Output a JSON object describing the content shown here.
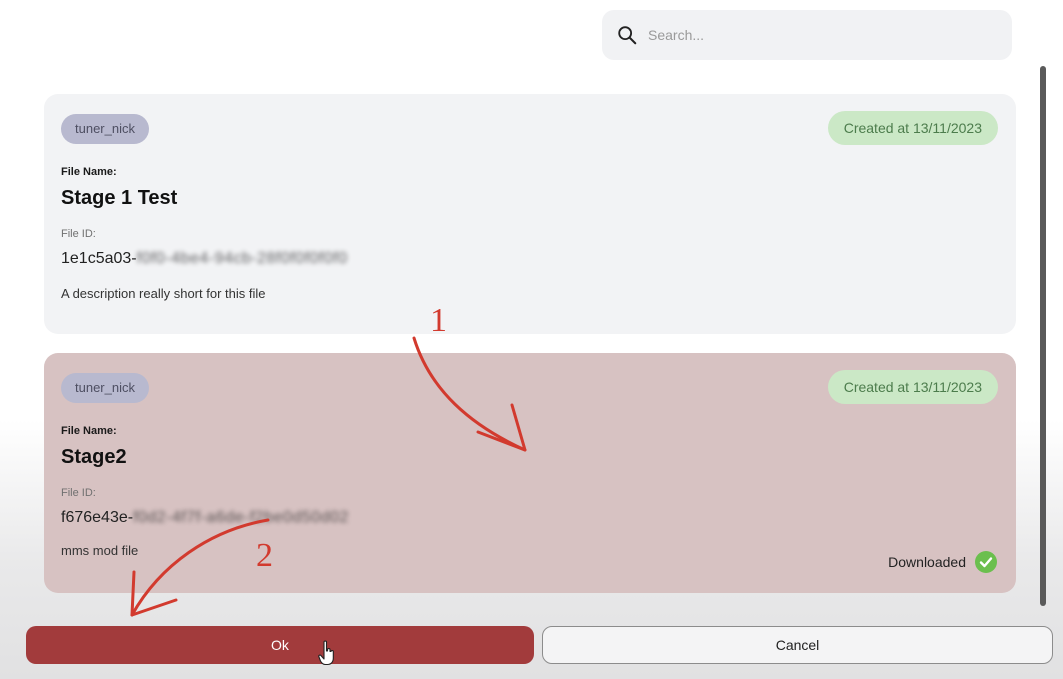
{
  "search": {
    "placeholder": "Search..."
  },
  "files": [
    {
      "owner": "tuner_nick",
      "created": "Created at 13/11/2023",
      "file_name_label": "File Name:",
      "file_name": "Stage 1 Test",
      "file_id_label": "File ID:",
      "file_id_visible": "1e1c5a03-",
      "file_id_obscured": "f0f0-4be4-94cb-28f0f0f0f0f0",
      "description": "A description really short for this file"
    },
    {
      "owner": "tuner_nick",
      "created": "Created at 13/11/2023",
      "file_name_label": "File Name:",
      "file_name": "Stage2",
      "file_id_label": "File ID:",
      "file_id_visible": "f676e43e-",
      "file_id_obscured": "f0d2-4f7f-a6de-f2be0d50d02",
      "description": "mms mod file",
      "status": "Downloaded"
    }
  ],
  "buttons": {
    "ok": "Ok",
    "cancel": "Cancel"
  },
  "annotations": {
    "step1": "1",
    "step2": "2"
  },
  "colors": {
    "selected_card": "#d7c2c2",
    "ok_button": "#a23b3c",
    "created_badge": "#cbe8c6",
    "owner_badge": "#b8b9cf",
    "annotation": "#d23a2e",
    "downloaded_check": "#6bbf4e"
  }
}
